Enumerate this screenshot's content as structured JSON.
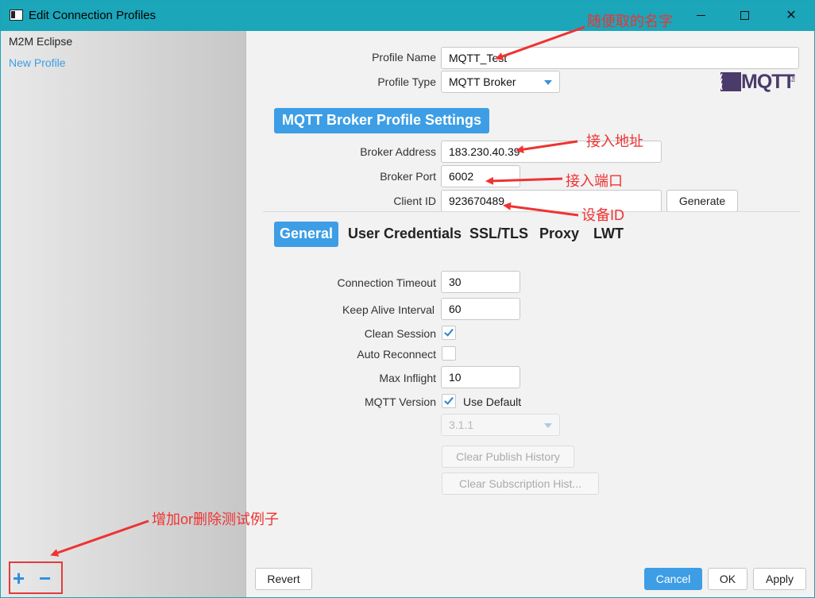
{
  "window": {
    "title": "Edit Connection Profiles",
    "minimize": "",
    "maximize": "",
    "close": "✕"
  },
  "sidebar": {
    "profiles": [
      {
        "label": "M2M Eclipse",
        "selected": false
      },
      {
        "label": "New Profile",
        "selected": true
      }
    ],
    "add_label": "+",
    "remove_label": "−"
  },
  "profile": {
    "name_label": "Profile Name",
    "name_value": "MQTT_Test",
    "type_label": "Profile Type",
    "type_value": "MQTT Broker",
    "logo_text": "MQTT",
    "logo_subtext": ".org"
  },
  "broker": {
    "section_title": "MQTT Broker Profile Settings",
    "address_label": "Broker Address",
    "address_value": "183.230.40.39",
    "port_label": "Broker Port",
    "port_value": "6002",
    "client_id_label": "Client ID",
    "client_id_value": "923670489",
    "generate_label": "Generate"
  },
  "tabs": [
    {
      "label": "General",
      "active": true
    },
    {
      "label": "User Credentials",
      "active": false
    },
    {
      "label": "SSL/TLS",
      "active": false
    },
    {
      "label": "Proxy",
      "active": false
    },
    {
      "label": "LWT",
      "active": false
    }
  ],
  "general": {
    "connection_timeout_label": "Connection Timeout",
    "connection_timeout_value": "30",
    "keep_alive_label": "Keep Alive Interval",
    "keep_alive_value": "60",
    "clean_session_label": "Clean Session",
    "clean_session_checked": true,
    "auto_reconnect_label": "Auto Reconnect",
    "auto_reconnect_checked": false,
    "max_inflight_label": "Max Inflight",
    "max_inflight_value": "10",
    "mqtt_version_label": "MQTT Version",
    "use_default_label": "Use Default",
    "use_default_checked": true,
    "version_value": "3.1.1",
    "clear_publish_label": "Clear Publish History",
    "clear_subscription_label": "Clear Subscription Hist..."
  },
  "footer": {
    "revert_label": "Revert",
    "cancel_label": "Cancel",
    "ok_label": "OK",
    "apply_label": "Apply"
  },
  "annotations": {
    "name_note": "随便取的名字",
    "address_note": "接入地址",
    "port_note": "接入端口",
    "device_note": "设备ID",
    "add_remove_note": "增加or删除测试例子"
  },
  "colors": {
    "titlebar": "#1ba6ba",
    "accent": "#3d9ee5",
    "annotation": "#ee3333",
    "selected_profile": "#3d9ee5"
  }
}
